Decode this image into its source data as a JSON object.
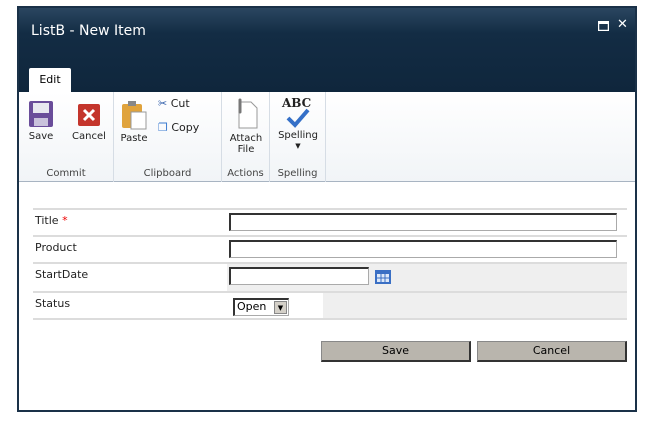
{
  "window": {
    "title": "ListB - New Item",
    "maximize_icon": "maximize-icon",
    "close_icon": "close-icon"
  },
  "ribbon": {
    "tab": "Edit",
    "groups": [
      {
        "label": "Commit",
        "buttons": [
          "Save",
          "Cancel"
        ]
      },
      {
        "label": "Clipboard",
        "buttons": [
          "Paste",
          "Cut",
          "Copy"
        ]
      },
      {
        "label": "Actions",
        "buttons": [
          "Attach File"
        ]
      },
      {
        "label": "Spelling",
        "buttons": [
          "Spelling"
        ]
      }
    ],
    "attach_line1": "Attach",
    "attach_line2": "File",
    "spelling_text": "ABC"
  },
  "form": {
    "fields": [
      {
        "label": "Title",
        "required": "*",
        "value": ""
      },
      {
        "label": "Product",
        "value": ""
      },
      {
        "label": "StartDate",
        "value": ""
      },
      {
        "label": "Status",
        "value": "Open"
      }
    ],
    "save": "Save",
    "cancel": "Cancel"
  }
}
